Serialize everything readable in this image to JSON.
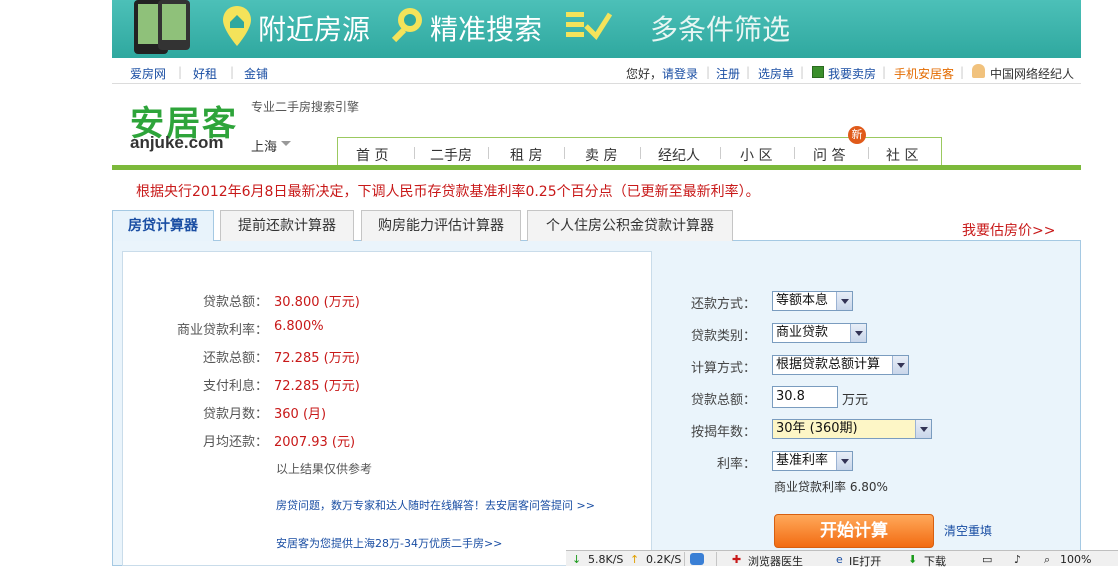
{
  "banner": {
    "items": [
      "附近房源",
      "精准搜索",
      "多条件筛选"
    ]
  },
  "topnav": {
    "left_links": [
      "爱房网",
      "好租",
      "金铺"
    ],
    "greeting": "您好，",
    "login": "请登录",
    "register": "注册",
    "selection_list": "选房单",
    "sell": "我要卖房",
    "mobile": "手机安居客",
    "agent_network": "中国网络经纪人"
  },
  "logo": {
    "cn": "安居客",
    "en": "anjuke.com",
    "slogan": "专业二手房搜索引擎",
    "city": "上海"
  },
  "mainnav": {
    "items": [
      "首 页",
      "二手房",
      "租 房",
      "卖 房",
      "经纪人",
      "小 区",
      "问 答",
      "社 区"
    ],
    "new_badge": "新"
  },
  "notice": "根据央行2012年6月8日最新决定，下调人民币存贷款基准利率0.25个百分点（已更新至最新利率）。",
  "tabs": [
    "房贷计算器",
    "提前还款计算器",
    "购房能力评估计算器",
    "个人住房公积金贷款计算器"
  ],
  "estimate_link": "我要估房价>>",
  "results": {
    "rows": [
      {
        "label": "贷款总额：",
        "value": "30.800 (万元)"
      },
      {
        "label": "商业贷款利率：",
        "value": "6.800%"
      },
      {
        "label": "还款总额：",
        "value": "72.285 (万元)"
      },
      {
        "label": "支付利息：",
        "value": "72.285 (万元)"
      },
      {
        "label": "贷款月数：",
        "value": "360 (月)"
      },
      {
        "label": "月均还款：",
        "value": "2007.93 (元)"
      }
    ],
    "note": "以上结果仅供参考",
    "link1": "房贷问题，数万专家和达人随时在线解答！去安居客问答提问 >>",
    "link2": "安居客为您提供上海28万-34万优质二手房>>"
  },
  "form": {
    "repay_method_label": "还款方式：",
    "repay_method_value": "等额本息",
    "loan_type_label": "贷款类别：",
    "loan_type_value": "商业贷款",
    "calc_method_label": "计算方式：",
    "calc_method_value": "根据贷款总额计算",
    "loan_amount_label": "贷款总额：",
    "loan_amount_value": "30.8",
    "loan_amount_unit": "万元",
    "years_label": "按揭年数：",
    "years_value": "30年 (360期)",
    "rate_label": "利率：",
    "rate_value": "基准利率",
    "rate_note": "商业贷款利率  6.80%",
    "calc_button": "开始计算",
    "reset": "清空重填"
  },
  "statusbar": {
    "down_speed": "5.8K/S",
    "up_speed": "0.2K/S",
    "browser_doctor": "浏览器医生",
    "ie_open": "IE打开",
    "download": "下载",
    "zoom": "100%"
  },
  "colors": {
    "banner": "#3cb4ab",
    "accent_green": "#7cb93b",
    "link_blue": "#1a4ea3",
    "alert_red": "#c81919",
    "button_orange": "#f26b12"
  }
}
